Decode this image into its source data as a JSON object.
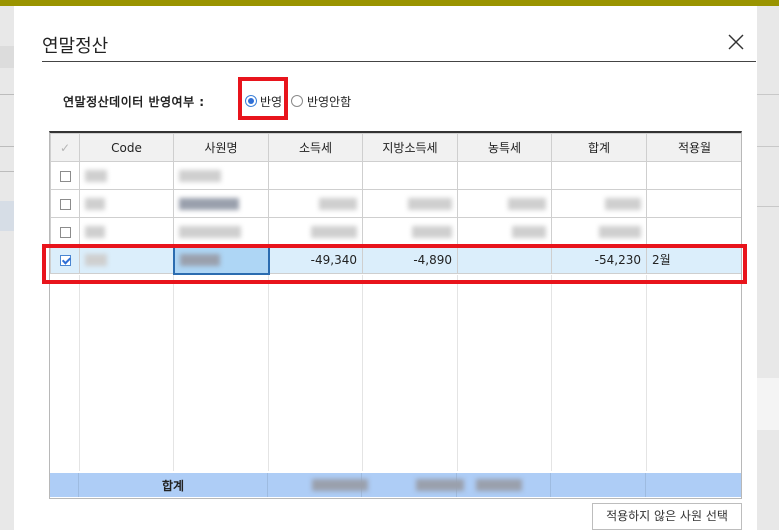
{
  "dialog": {
    "title": "연말정산",
    "option_label": "연말정산데이터 반영여부 :",
    "options": [
      {
        "label": "반영",
        "selected": true
      },
      {
        "label": "반영안함",
        "selected": false
      }
    ]
  },
  "grid": {
    "columns": [
      "Code",
      "사원명",
      "소득세",
      "지방소득세",
      "농특세",
      "합계",
      "적용월"
    ],
    "selected_row": {
      "checked": true,
      "income_tax": "-49,340",
      "local_income_tax": "-4,890",
      "total": "-54,230",
      "month": "2월"
    },
    "footer_label": "합계"
  },
  "buttons": {
    "select_unapplied": "적용하지 않은 사원 선택"
  },
  "colors": {
    "highlight_red": "#e8141c",
    "selected_row_bg": "#dbeefb",
    "footer_bg": "#aecdf6",
    "radio_accent": "#2f6fd6"
  },
  "icons": [
    "close-icon",
    "checkbox-icon",
    "radio-icon"
  ]
}
